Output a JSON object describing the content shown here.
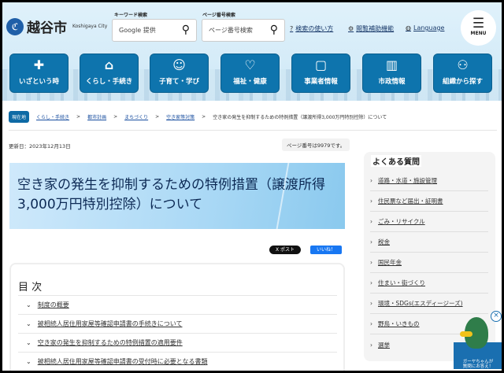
{
  "header": {
    "logo_jp": "越谷市",
    "logo_en": "Koshigaya City",
    "keyword_label": "キーワード検索",
    "keyword_placeholder": "Google 提供",
    "pageno_label": "ページ番号検索",
    "pageno_placeholder": "ページ番号検索",
    "links": [
      {
        "icon": "?",
        "label": "検索の使い方"
      },
      {
        "icon": "⚙",
        "label": "閲覧補助機能"
      },
      {
        "icon": "◍",
        "label": "Language"
      }
    ],
    "menu_label": "MENU"
  },
  "nav": [
    {
      "icon": "✚",
      "label": "いざという時"
    },
    {
      "icon": "⌂",
      "label": "くらし・手続き"
    },
    {
      "icon": "☺",
      "label": "子育て・学び"
    },
    {
      "icon": "♡",
      "label": "福祉・健康"
    },
    {
      "icon": "▢",
      "label": "事業者情報"
    },
    {
      "icon": "▥",
      "label": "市政情報"
    },
    {
      "icon": "⚇",
      "label": "組織から探す"
    }
  ],
  "breadcrumb": {
    "here": "現在地",
    "items": [
      "くらし・手続き",
      "都市計画",
      "まちづくり",
      "空き家等対策"
    ],
    "current": "空き家の発生を抑制するための特例措置（譲渡所得3,000万円特別控除）について"
  },
  "updated": "更新日：2023年12月13日",
  "page_number": "ページ番号は9979です。",
  "title_line1": "空き家の発生を抑制するための特例措置（譲渡所得",
  "title_line2": "3,000万円特別控除）について",
  "social": {
    "x": "X ポスト",
    "fb": "いいね！"
  },
  "toc": {
    "title": "目 次",
    "items": [
      "制度の概要",
      "被相続人居住用家屋等確認申請書の手続きについて",
      "空き家の発生を抑制するための特例措置の適用要件",
      "被相続人居住用家屋等確認申請書の受付時に必要となる書類"
    ]
  },
  "faq": {
    "title": "よくある質問",
    "items": [
      "道路・水道・施設管理",
      "住民票など届出・証明書",
      "ごみ・リサイクル",
      "税金",
      "国民年金",
      "住まい・街づくり",
      "環境・SDGs(エスディージーズ)",
      "野鳥・いきもの",
      "選挙"
    ]
  },
  "mascot": {
    "text1": "ガーヤちゃんが",
    "text2": "質問にお答え！"
  }
}
